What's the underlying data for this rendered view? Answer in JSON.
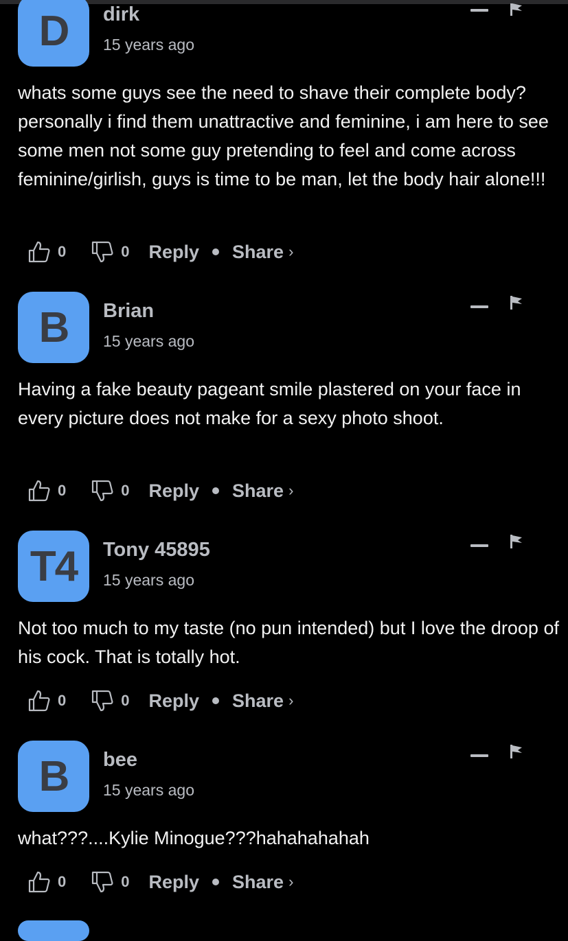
{
  "comments": [
    {
      "avatar_letter": "D",
      "author": "dirk",
      "time": "15 years ago",
      "text": "whats some guys see the need to shave their complete body? personally i find them unattractive and feminine, i am here to see some men not some guy pretending to feel and come across feminine/girlish, guys is time to be man, let the body hair alone!!!",
      "upvotes": "0",
      "downvotes": "0",
      "reply_label": "Reply",
      "share_label": "Share",
      "share_chevron": "›"
    },
    {
      "avatar_letter": "B",
      "author": "Brian",
      "time": "15 years ago",
      "text": "Having a fake beauty pageant smile plastered on your face in every picture does not make for a sexy photo shoot.",
      "upvotes": "0",
      "downvotes": "0",
      "reply_label": "Reply",
      "share_label": "Share",
      "share_chevron": "›"
    },
    {
      "avatar_letter": "T4",
      "author": "Tony 45895",
      "time": "15 years ago",
      "text": "Not too much to my taste (no pun intended) but I love the droop of his cock. That is totally hot.",
      "upvotes": "0",
      "downvotes": "0",
      "reply_label": "Reply",
      "share_label": "Share",
      "share_chevron": "›"
    },
    {
      "avatar_letter": "B",
      "author": "bee",
      "time": "15 years ago",
      "text": "what???....Kylie Minogue???hahahahahah",
      "upvotes": "0",
      "downvotes": "0",
      "reply_label": "Reply",
      "share_label": "Share",
      "share_chevron": "›"
    }
  ],
  "colors": {
    "background": "#000000",
    "avatar": "#5aa0f2",
    "avatar_letter": "#3a3d44",
    "muted_text": "#b9bcc2",
    "body_text": "#f2f2f2"
  },
  "icons": [
    "thumbs-up-icon",
    "thumbs-down-icon",
    "collapse-icon",
    "flag-icon",
    "chevron-right-icon"
  ]
}
